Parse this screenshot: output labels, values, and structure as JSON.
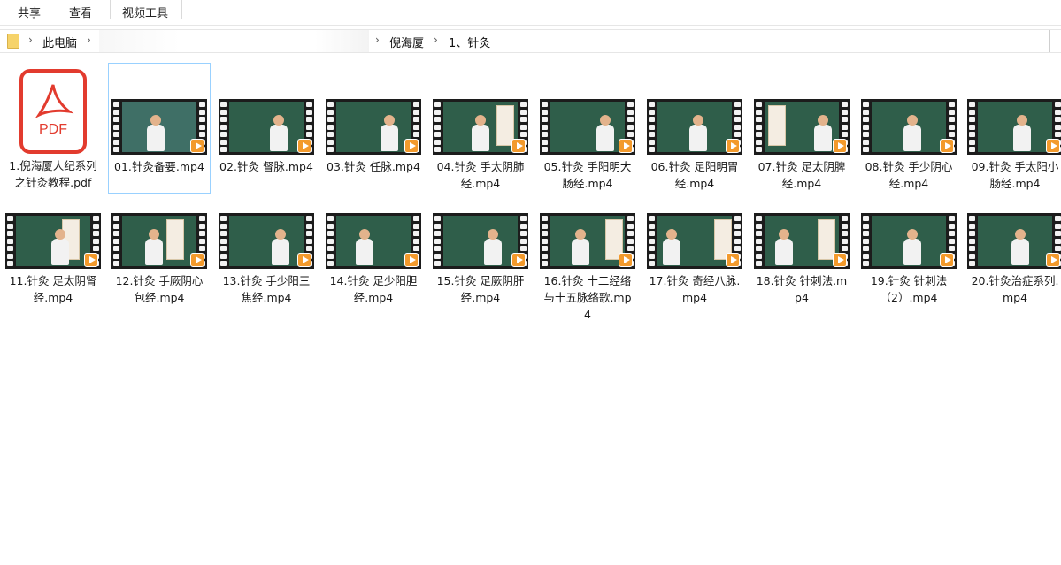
{
  "ribbon": {
    "tabs": [
      "共享",
      "查看",
      "视频工具"
    ]
  },
  "address": {
    "crumbs": [
      "此电脑",
      "倪海厦",
      "1、针灸"
    ]
  },
  "files": [
    {
      "name": "1.倪海厦人纪系列之针灸教程.pdf",
      "type": "pdf",
      "icon_text": "PDF"
    },
    {
      "name": "01.针灸备要.mp4",
      "type": "video",
      "selected": true
    },
    {
      "name": "02.针灸 督脉.mp4",
      "type": "video"
    },
    {
      "name": "03.针灸 任脉.mp4",
      "type": "video"
    },
    {
      "name": "04.针灸 手太阴肺经.mp4",
      "type": "video"
    },
    {
      "name": "05.针灸 手阳明大肠经.mp4",
      "type": "video"
    },
    {
      "name": "06.针灸 足阳明胃经.mp4",
      "type": "video"
    },
    {
      "name": "07.针灸 足太阴脾经.mp4",
      "type": "video"
    },
    {
      "name": "08.针灸 手少阴心经.mp4",
      "type": "video"
    },
    {
      "name": "09.针灸 手太阳小肠经.mp4",
      "type": "video"
    },
    {
      "name": "11.针灸 足太阴肾经.mp4",
      "type": "video"
    },
    {
      "name": "12.针灸 手厥阴心包经.mp4",
      "type": "video"
    },
    {
      "name": "13.针灸 手少阳三焦经.mp4",
      "type": "video"
    },
    {
      "name": "14.针灸 足少阳胆经.mp4",
      "type": "video"
    },
    {
      "name": "15.针灸 足厥阴肝经.mp4",
      "type": "video"
    },
    {
      "name": "16.针灸 十二经络与十五脉络歌.mp4",
      "type": "video"
    },
    {
      "name": "17.针灸 奇经八脉.mp4",
      "type": "video"
    },
    {
      "name": "18.针灸 针刺法.mp4",
      "type": "video"
    },
    {
      "name": "19.针灸 针刺法（2）.mp4",
      "type": "video"
    },
    {
      "name": "20.针灸治症系列.mp4",
      "type": "video"
    }
  ]
}
